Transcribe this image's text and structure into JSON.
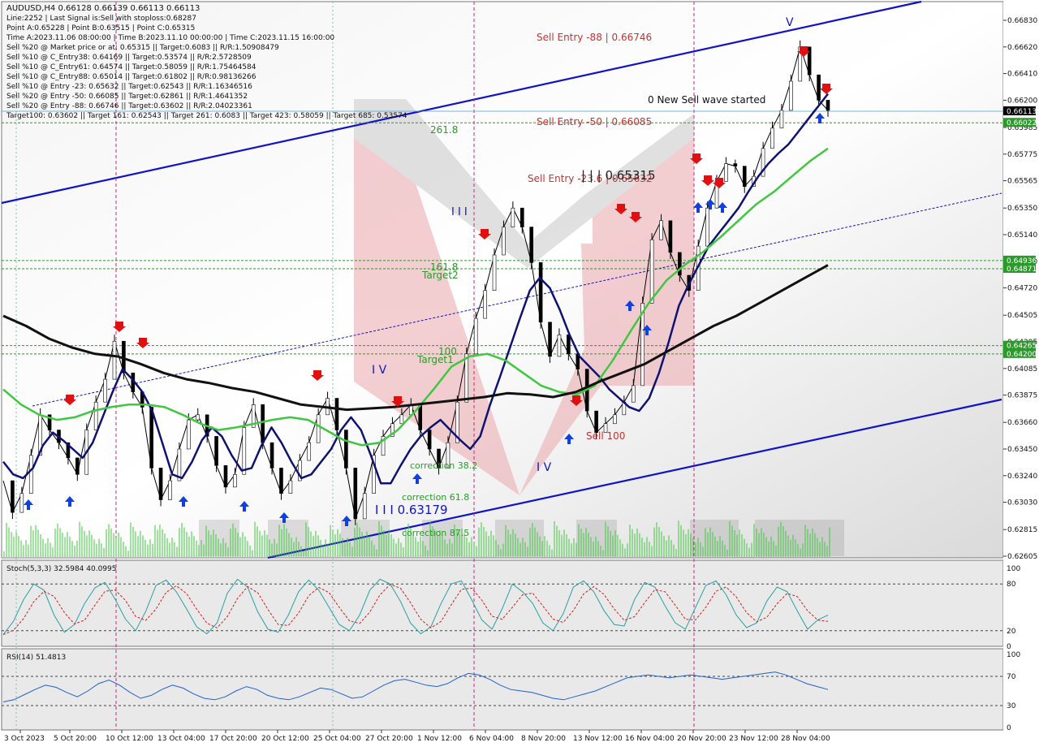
{
  "header": {
    "symbol": "AUDUSD,H4  0.66128 0.66139 0.66113 0.66113",
    "info_lines": [
      "Line:2252  | Last Signal is:Sell with stoploss:0.68287",
      "Point A:0.65228  | Point B:0.63515  | Point C:0.65315",
      "Time A:2023.11.06 08:00:00  | Time B:2023.11.10 00:00:00  | Time C:2023.11.15 16:00:00",
      "Sell %20 @ Market price or at: 0.65315  || Target:0.6083  || R/R:1.50908479",
      "Sell %10 @ C_Entry38: 0.64169  || Target:0.53574  || R/R:2.5728509",
      "Sell %10 @ C_Entry61: 0.64574  || Target:0.58059  || R/R:1.75464584",
      "Sell %10 @ C_Entry88: 0.65014  || Target:0.61802  || R/R:0.98136266",
      "Sell %10 @ Entry -23: 0.65632  || Target:0.62543  || R/R:1.16346516",
      "Sell %20 @ Entry -50: 0.66085  || Target:0.62861  || R/R:1.4641352",
      "Sell %20 @ Entry -88: 0.66746  || Target:0.63602  || R/R:2.04023361",
      "Target100: 0.63602  || Target 161: 0.62543  || Target 261: 0.6083  || Target 423: 0.58059  || Target 685: 0.53574"
    ]
  },
  "annotations": {
    "sell_entry_88": "Sell Entry -88 | 0.66746",
    "sell_entry_50": "Sell Entry -50 | 0.66085",
    "sell_entry_23": "Sell Entry -23.6 | 0.65632",
    "point_c": "| | | 0.65315",
    "new_wave": "0 New Sell wave started",
    "fib_261": "261.8",
    "fib_161": "161.8",
    "target2": "Target2",
    "target1": "Target1",
    "t100": "100",
    "wave_iii": "I I I",
    "wave_iv_a": "I V",
    "wave_iv_b": "I V",
    "wave_v": "V",
    "sell_100": "Sell 100",
    "corr_382": "correction 38.2",
    "corr_618": "correction 61.8",
    "corr_875": "correction 87.5",
    "point_b": "I I I 0.63179"
  },
  "price_axis": {
    "ticks": [
      "0.66830",
      "0.66620",
      "0.66410",
      "0.66200",
      "0.65985",
      "0.65775",
      "0.65565",
      "0.65350",
      "0.65140",
      "0.64930",
      "0.64720",
      "0.64505",
      "0.64295",
      "0.64085",
      "0.63875",
      "0.63660",
      "0.63450",
      "0.63240",
      "0.63030",
      "0.62815",
      "0.62605"
    ],
    "current_price": "0.66113",
    "level_labels": [
      "0.66022",
      "0.64936",
      "0.64871",
      "0.64265",
      "0.64200"
    ],
    "colors": {
      "current": "#000000",
      "levels": "#2a9a2a"
    }
  },
  "time_axis": {
    "labels": [
      "3 Oct 2023",
      "5 Oct 20:00",
      "10 Oct 12:00",
      "13 Oct 04:00",
      "17 Oct 20:00",
      "20 Oct 12:00",
      "25 Oct 04:00",
      "27 Oct 20:00",
      "1 Nov 12:00",
      "6 Nov 04:00",
      "8 Nov 20:00",
      "13 Nov 12:00",
      "16 Nov 04:00",
      "20 Nov 20:00",
      "23 Nov 12:00",
      "28 Nov 04:00"
    ]
  },
  "stoch": {
    "title": "Stoch(5,3,3) 32.5984 40.0995",
    "levels": [
      "100",
      "80",
      "20",
      "0"
    ]
  },
  "rsi": {
    "title": "RSI(14) 51.4813",
    "levels": [
      "100",
      "70",
      "30",
      "0"
    ]
  },
  "chart_data": {
    "type": "line",
    "symbol": "AUDUSD",
    "timeframe": "H4",
    "ylim": [
      0.62605,
      0.6693
    ],
    "x_range": [
      "2023-10-03",
      "2023-11-30"
    ],
    "series": [
      {
        "name": "close",
        "color": "#000000",
        "values": [
          0.632,
          0.6295,
          0.631,
          0.634,
          0.6372,
          0.636,
          0.635,
          0.6338,
          0.6325,
          0.636,
          0.6382,
          0.64,
          0.643,
          0.6405,
          0.639,
          0.6378,
          0.633,
          0.6305,
          0.632,
          0.6345,
          0.6368,
          0.6372,
          0.6355,
          0.6332,
          0.6315,
          0.6325,
          0.6362,
          0.638,
          0.635,
          0.633,
          0.631,
          0.632,
          0.6336,
          0.635,
          0.6372,
          0.6385,
          0.636,
          0.633,
          0.629,
          0.631,
          0.634,
          0.6355,
          0.6365,
          0.6372,
          0.638,
          0.636,
          0.6345,
          0.633,
          0.635,
          0.6382,
          0.642,
          0.6448,
          0.647,
          0.6498,
          0.652,
          0.6535,
          0.652,
          0.6492,
          0.6445,
          0.6418,
          0.6435,
          0.642,
          0.6408,
          0.6375,
          0.6358,
          0.6365,
          0.6372,
          0.6382,
          0.6395,
          0.646,
          0.651,
          0.6525,
          0.65,
          0.6482,
          0.647,
          0.6505,
          0.6535,
          0.6556,
          0.657,
          0.6568,
          0.6552,
          0.656,
          0.6582,
          0.6598,
          0.6612,
          0.6635,
          0.6662,
          0.664,
          0.662,
          0.6612
        ]
      },
      {
        "name": "MA fast",
        "color": "#0f1270",
        "values": [
          0.6335,
          0.6325,
          0.6322,
          0.633,
          0.6348,
          0.6358,
          0.6352,
          0.6345,
          0.6338,
          0.635,
          0.637,
          0.639,
          0.6408,
          0.64,
          0.639,
          0.6375,
          0.635,
          0.6325,
          0.6322,
          0.6335,
          0.6352,
          0.6362,
          0.6355,
          0.634,
          0.6328,
          0.633,
          0.6348,
          0.6362,
          0.635,
          0.6335,
          0.6322,
          0.6325,
          0.6335,
          0.6345,
          0.636,
          0.637,
          0.636,
          0.634,
          0.6318,
          0.6318,
          0.6332,
          0.6345,
          0.6355,
          0.6362,
          0.6368,
          0.636,
          0.6352,
          0.6345,
          0.6355,
          0.638,
          0.6402,
          0.6425,
          0.6448,
          0.647,
          0.648,
          0.6472,
          0.6455,
          0.6435,
          0.6418,
          0.641,
          0.6402,
          0.6392,
          0.6385,
          0.6378,
          0.6375,
          0.6385,
          0.6405,
          0.643,
          0.6458,
          0.6475,
          0.649,
          0.6505,
          0.6515,
          0.6525,
          0.6535,
          0.6548,
          0.656,
          0.657,
          0.6578,
          0.6585,
          0.6595,
          0.6605,
          0.6615,
          0.6625
        ]
      },
      {
        "name": "MA mid",
        "color": "#3fc83f",
        "values": [
          0.6392,
          0.638,
          0.6372,
          0.6368,
          0.637,
          0.6375,
          0.6378,
          0.638,
          0.638,
          0.6378,
          0.6372,
          0.6365,
          0.636,
          0.6362,
          0.6365,
          0.6368,
          0.637,
          0.6368,
          0.636,
          0.6352,
          0.6348,
          0.635,
          0.636,
          0.6375,
          0.6392,
          0.641,
          0.6418,
          0.642,
          0.6415,
          0.6405,
          0.6395,
          0.639,
          0.6388,
          0.6395,
          0.6415,
          0.6438,
          0.646,
          0.6478,
          0.649,
          0.65,
          0.6512,
          0.6525,
          0.6538,
          0.6548,
          0.656,
          0.6572,
          0.6582
        ]
      },
      {
        "name": "MA slow",
        "color": "#111111",
        "values": [
          0.645,
          0.6442,
          0.6432,
          0.6425,
          0.642,
          0.6418,
          0.6412,
          0.6405,
          0.64,
          0.6397,
          0.6393,
          0.639,
          0.6385,
          0.638,
          0.6378,
          0.6376,
          0.6377,
          0.6378,
          0.638,
          0.6382,
          0.6384,
          0.6386,
          0.6389,
          0.6388,
          0.6386,
          0.639,
          0.6398,
          0.6405,
          0.6412,
          0.6422,
          0.6432,
          0.6442,
          0.645,
          0.646,
          0.647,
          0.648,
          0.649
        ]
      }
    ],
    "levels": [
      {
        "name": "current",
        "value": 0.66113
      },
      {
        "value": 0.66022
      },
      {
        "value": 0.64936
      },
      {
        "value": 0.64871
      },
      {
        "value": 0.64265
      },
      {
        "value": 0.642
      }
    ],
    "stoch_values": [
      15,
      32,
      60,
      80,
      72,
      40,
      18,
      28,
      55,
      75,
      82,
      60,
      35,
      20,
      45,
      78,
      85,
      70,
      48,
      25,
      16,
      30,
      68,
      86,
      76,
      44,
      22,
      18,
      40,
      70,
      85,
      72,
      50,
      28,
      20,
      40,
      72,
      86,
      80,
      58,
      30,
      16,
      25,
      55,
      80,
      84,
      60,
      34,
      22,
      48,
      80,
      70,
      55,
      30,
      20,
      42,
      76,
      84,
      70,
      46,
      28,
      26,
      60,
      82,
      76,
      52,
      30,
      22,
      50,
      78,
      84,
      66,
      40,
      24,
      30,
      58,
      76,
      70,
      45,
      22,
      34,
      40
    ],
    "rsi_values": [
      35,
      38,
      45,
      52,
      58,
      55,
      48,
      42,
      50,
      60,
      65,
      58,
      48,
      40,
      44,
      52,
      58,
      54,
      46,
      40,
      38,
      42,
      50,
      56,
      52,
      44,
      40,
      38,
      42,
      48,
      54,
      52,
      46,
      40,
      42,
      50,
      58,
      64,
      66,
      62,
      58,
      56,
      60,
      68,
      74,
      72,
      66,
      58,
      52,
      50,
      48,
      44,
      40,
      38,
      42,
      46,
      50,
      56,
      62,
      68,
      70,
      72,
      70,
      68,
      70,
      72,
      70,
      68,
      66,
      68,
      70,
      72,
      74,
      76,
      72,
      66,
      60,
      56,
      52
    ]
  }
}
